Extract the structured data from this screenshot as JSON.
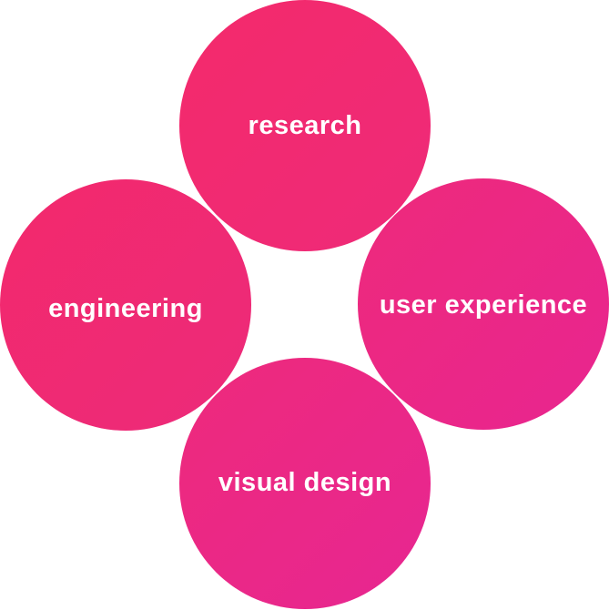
{
  "diagram": {
    "nodes": [
      {
        "id": "research",
        "label": "research"
      },
      {
        "id": "engineering",
        "label": "engineering"
      },
      {
        "id": "user-experience",
        "label": "user experience"
      },
      {
        "id": "visual-design",
        "label": "visual design"
      }
    ],
    "colors": {
      "primary": "#f42a6b",
      "secondary": "#e82590",
      "text": "#ffffff"
    }
  }
}
